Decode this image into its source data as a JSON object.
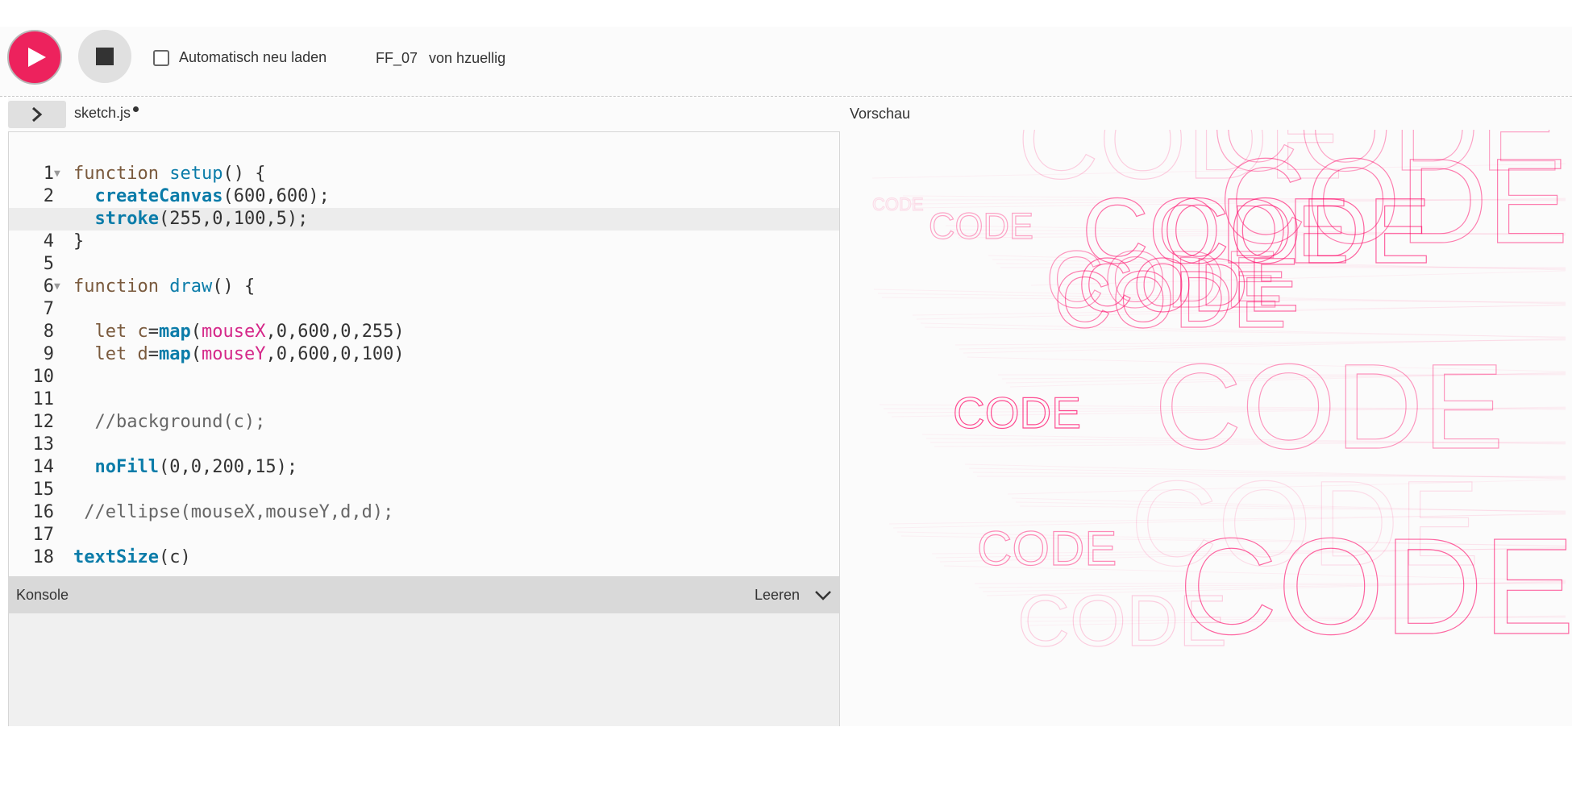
{
  "toolbar": {
    "play_label": "Play",
    "stop_label": "Stop",
    "autorefresh_label": "Automatisch neu laden",
    "autorefresh_checked": false,
    "project_name": "FF_07",
    "author_text": "von hzuellig"
  },
  "editor": {
    "file_name": "sketch.js",
    "unsaved": true,
    "active_line": 3,
    "lines": [
      {
        "n": "1",
        "fold": true
      },
      {
        "n": "2"
      },
      {
        "n": "3"
      },
      {
        "n": "4"
      },
      {
        "n": "5"
      },
      {
        "n": "6",
        "fold": true
      },
      {
        "n": "7"
      },
      {
        "n": "8"
      },
      {
        "n": "9"
      },
      {
        "n": "10"
      },
      {
        "n": "11"
      },
      {
        "n": "12"
      },
      {
        "n": "13"
      },
      {
        "n": "14"
      },
      {
        "n": "15"
      },
      {
        "n": "16"
      },
      {
        "n": "17"
      },
      {
        "n": "18"
      }
    ],
    "code": {
      "l1_kw": "function",
      "l1_fn": "setup",
      "l1_rest": "() {",
      "l2_fn": "createCanvas",
      "l2_rest": "(600,600);",
      "l3_fn": "stroke",
      "l3_rest": "(255,0,100,5);",
      "l4": "}",
      "l6_kw": "function",
      "l6_fn": "draw",
      "l6_rest": "() {",
      "l8_kw": "let",
      "l8_var": "c",
      "l8_eq": "=",
      "l8_fn": "map",
      "l8_open": "(",
      "l8_arg": "mouseX",
      "l8_rest": ",0,600,0,255)",
      "l9_kw": "let",
      "l9_var": "d",
      "l9_eq": "=",
      "l9_fn": "map",
      "l9_open": "(",
      "l9_arg": "mouseY",
      "l9_rest": ",0,600,0,100)",
      "l12": "//background(c);",
      "l14_fn": "noFill",
      "l14_rest": "(0,0,200,15);",
      "l16": "//ellipse(mouseX,mouseY,d,d);",
      "l18_fn": "textSize",
      "l18_rest": "(c)"
    }
  },
  "console": {
    "title": "Konsole",
    "clear_label": "Leeren"
  },
  "preview": {
    "title": "Vorschau",
    "canvas_word": "CODE"
  },
  "colors": {
    "accent": "#ed225d",
    "stroke": "#ff0064"
  }
}
